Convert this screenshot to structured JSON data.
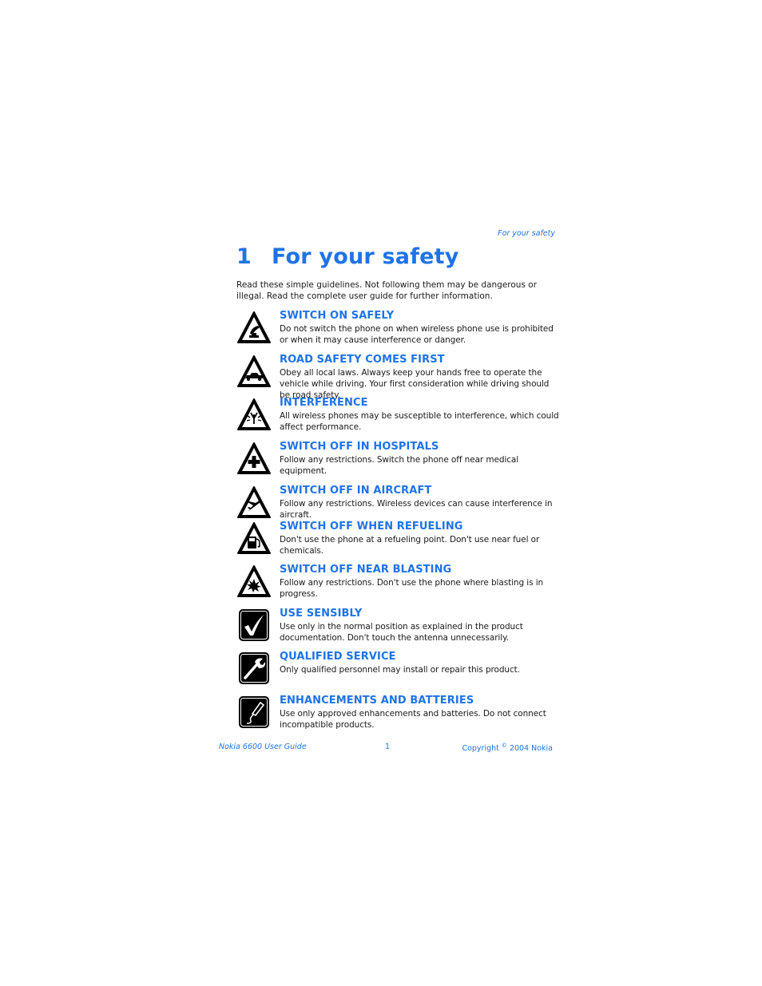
{
  "running_header": "For your safety",
  "chapter": {
    "number": "1",
    "title": "For your safety"
  },
  "intro": "Read these simple guidelines. Not following them may be dangerous or illegal. Read the complete user guide for further information.",
  "items": [
    {
      "icon": "switch-on-safely-icon",
      "title": "SWITCH ON SAFELY",
      "text": "Do not switch the phone on when wireless phone use is prohibited or when it may cause interference or danger."
    },
    {
      "icon": "car-icon",
      "title": "ROAD SAFETY COMES FIRST",
      "text": "Obey all local laws. Always keep your hands free to operate the vehicle while driving. Your first consideration while driving should be road safety."
    },
    {
      "icon": "interference-icon",
      "title": "INTERFERENCE",
      "text": "All wireless phones may be susceptible to interference, which could affect performance."
    },
    {
      "icon": "medical-cross-icon",
      "title": "SWITCH OFF IN HOSPITALS",
      "text": "Follow any restrictions. Switch the phone off near medical equipment."
    },
    {
      "icon": "airplane-icon",
      "title": "SWITCH OFF IN AIRCRAFT",
      "text": "Follow any restrictions. Wireless devices can cause interference in aircraft."
    },
    {
      "icon": "fuel-pump-icon",
      "title": "SWITCH OFF WHEN REFUELING",
      "text": "Don't use the phone at a refueling point. Don't use near fuel or chemicals."
    },
    {
      "icon": "explosion-icon",
      "title": "SWITCH OFF NEAR BLASTING",
      "text": "Follow any restrictions. Don't use the phone where blasting is in progress."
    },
    {
      "icon": "checkmark-icon",
      "title": "USE SENSIBLY",
      "text": "Use only in the normal position as explained in the product documentation. Don't touch the antenna unnecessarily."
    },
    {
      "icon": "wrench-icon",
      "title": "QUALIFIED SERVICE",
      "text": "Only qualified personnel may install or repair this product."
    },
    {
      "icon": "cable-plug-icon",
      "title": "ENHANCEMENTS AND BATTERIES",
      "text": "Use only approved enhancements and batteries. Do not connect incompatible products."
    }
  ],
  "footer": {
    "guide": "Nokia 6600 User Guide",
    "page": "1",
    "copyright_prefix": "Copyright",
    "copyright_symbol": "©",
    "copyright_suffix": "2004 Nokia"
  },
  "colors": {
    "accent": "#1e73e8",
    "text": "#1a1a1a"
  }
}
